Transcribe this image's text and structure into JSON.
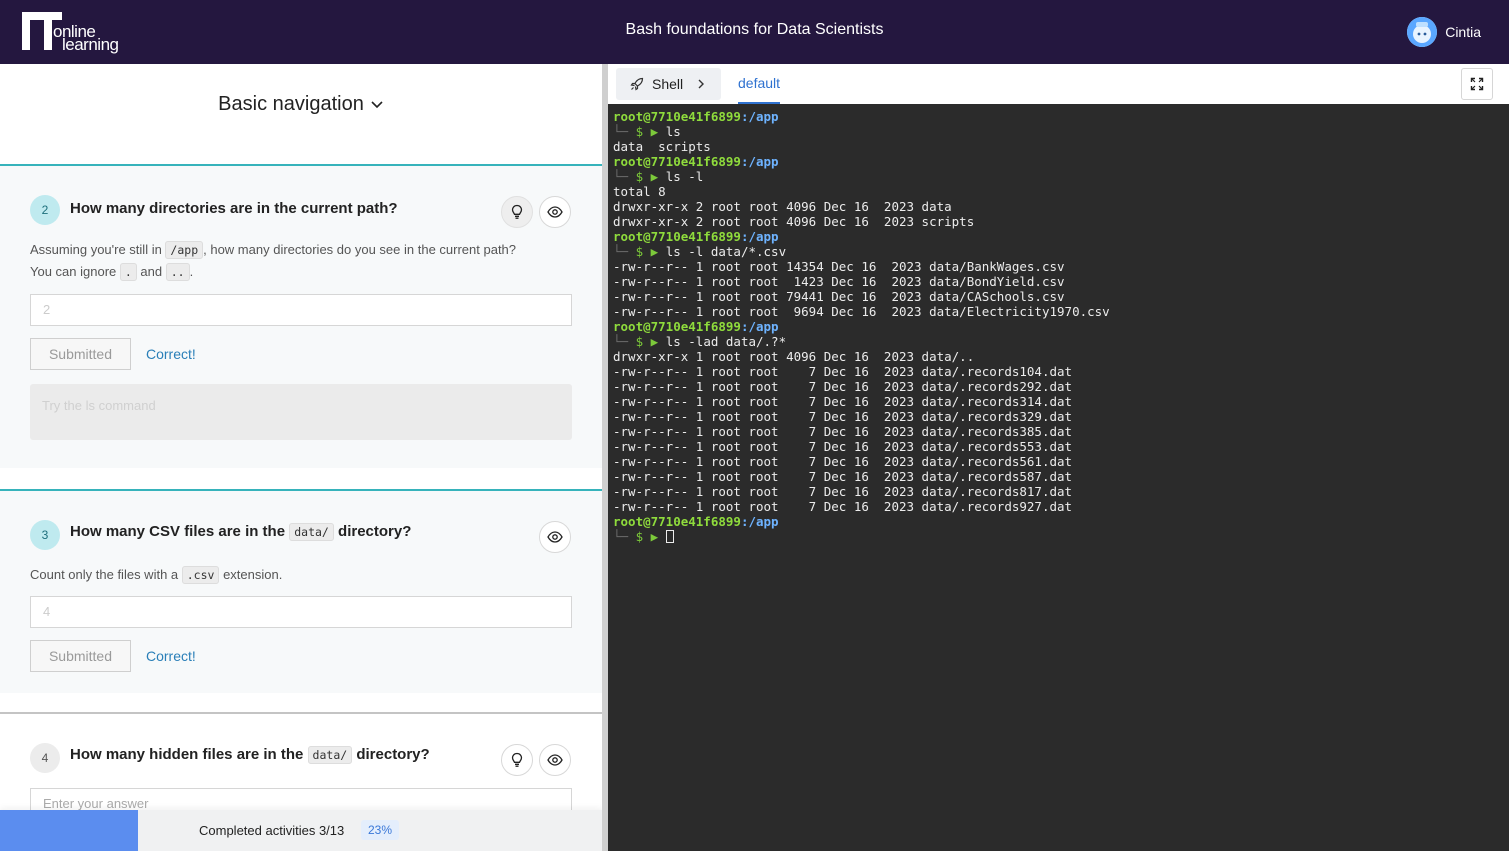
{
  "header": {
    "logo_line1": "online",
    "logo_line2": "learning",
    "course_title": "Bash foundations for Data Scientists",
    "user_name": "Cintia"
  },
  "lesson": {
    "title": "Basic navigation"
  },
  "questions": [
    {
      "number": "2",
      "title": "How many directories are in the current path?",
      "desc_part1": "Assuming you're still in ",
      "desc_code1": "/app",
      "desc_part2": ", how many directories do you see in the current path?",
      "desc_part3": "You can ignore ",
      "desc_code2": ".",
      "desc_part4": " and ",
      "desc_code3": "..",
      "desc_part5": ".",
      "answer_value": "2",
      "submitted_label": "Submitted",
      "status_label": "Correct!",
      "hint_part1": "Try the ",
      "hint_code": "ls",
      "hint_part2": " command"
    },
    {
      "number": "3",
      "title_part1": "How many CSV files are in the ",
      "title_code": "data/",
      "title_part2": " directory?",
      "desc_part1": "Count only the files with a ",
      "desc_code": ".csv",
      "desc_part2": " extension.",
      "answer_value": "4",
      "submitted_label": "Submitted",
      "status_label": "Correct!"
    },
    {
      "number": "4",
      "title_part1": "How many hidden files are in the ",
      "title_code": "data/",
      "title_part2": " directory?",
      "answer_placeholder": "Enter your answer"
    }
  ],
  "progress": {
    "label": "Completed activities 3/13",
    "percent_label": "23%",
    "fraction": 0.23
  },
  "tabs": {
    "shell_label": "Shell",
    "default_label": "default"
  },
  "terminal": {
    "prompt_user": "root@7710e41f6899",
    "prompt_path": ":/app",
    "lines": [
      {
        "kind": "prompt"
      },
      {
        "kind": "cmd",
        "text": "ls"
      },
      {
        "kind": "out",
        "text": "data  scripts"
      },
      {
        "kind": "prompt"
      },
      {
        "kind": "cmd",
        "text": "ls -l"
      },
      {
        "kind": "out",
        "text": "total 8"
      },
      {
        "kind": "out",
        "text": "drwxr-xr-x 2 root root 4096 Dec 16  2023 data"
      },
      {
        "kind": "out",
        "text": "drwxr-xr-x 2 root root 4096 Dec 16  2023 scripts"
      },
      {
        "kind": "prompt"
      },
      {
        "kind": "cmd",
        "text": "ls -l data/*.csv"
      },
      {
        "kind": "out",
        "text": "-rw-r--r-- 1 root root 14354 Dec 16  2023 data/BankWages.csv"
      },
      {
        "kind": "out",
        "text": "-rw-r--r-- 1 root root  1423 Dec 16  2023 data/BondYield.csv"
      },
      {
        "kind": "out",
        "text": "-rw-r--r-- 1 root root 79441 Dec 16  2023 data/CASchools.csv"
      },
      {
        "kind": "out",
        "text": "-rw-r--r-- 1 root root  9694 Dec 16  2023 data/Electricity1970.csv"
      },
      {
        "kind": "prompt"
      },
      {
        "kind": "cmd",
        "text": "ls -lad data/.?*"
      },
      {
        "kind": "out",
        "text": "drwxr-xr-x 1 root root 4096 Dec 16  2023 data/.."
      },
      {
        "kind": "out",
        "text": "-rw-r--r-- 1 root root    7 Dec 16  2023 data/.records104.dat"
      },
      {
        "kind": "out",
        "text": "-rw-r--r-- 1 root root    7 Dec 16  2023 data/.records292.dat"
      },
      {
        "kind": "out",
        "text": "-rw-r--r-- 1 root root    7 Dec 16  2023 data/.records314.dat"
      },
      {
        "kind": "out",
        "text": "-rw-r--r-- 1 root root    7 Dec 16  2023 data/.records329.dat"
      },
      {
        "kind": "out",
        "text": "-rw-r--r-- 1 root root    7 Dec 16  2023 data/.records385.dat"
      },
      {
        "kind": "out",
        "text": "-rw-r--r-- 1 root root    7 Dec 16  2023 data/.records553.dat"
      },
      {
        "kind": "out",
        "text": "-rw-r--r-- 1 root root    7 Dec 16  2023 data/.records561.dat"
      },
      {
        "kind": "out",
        "text": "-rw-r--r-- 1 root root    7 Dec 16  2023 data/.records587.dat"
      },
      {
        "kind": "out",
        "text": "-rw-r--r-- 1 root root    7 Dec 16  2023 data/.records817.dat"
      },
      {
        "kind": "out",
        "text": "-rw-r--r-- 1 root root    7 Dec 16  2023 data/.records927.dat"
      },
      {
        "kind": "prompt"
      },
      {
        "kind": "input"
      }
    ]
  },
  "colors": {
    "header_bg": "#24173f",
    "accent_teal": "#36b3bb",
    "link_blue": "#2a7fb8",
    "progress_blue": "#5b8def",
    "terminal_bg": "#2b2b2b"
  }
}
